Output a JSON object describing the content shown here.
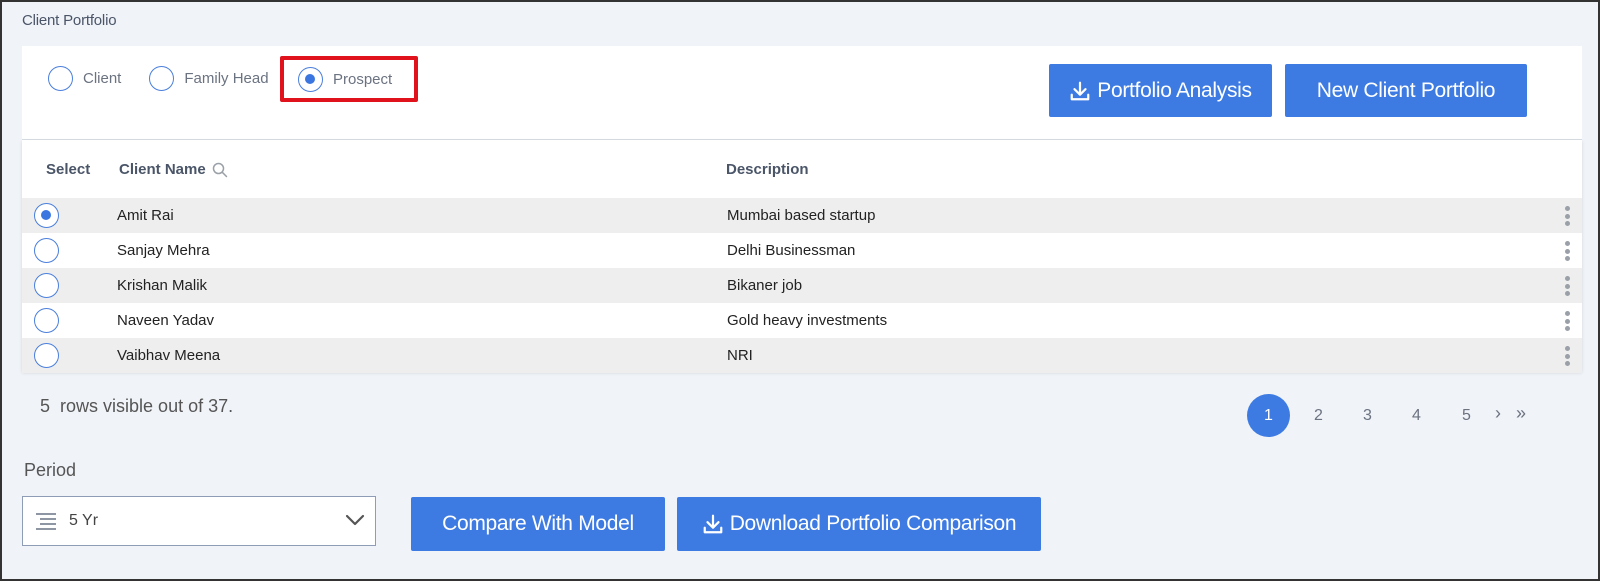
{
  "section_title": "Client Portfolio",
  "filter": {
    "options": [
      {
        "label": "Client",
        "checked": false
      },
      {
        "label": "Family Head",
        "checked": false
      },
      {
        "label": "Prospect",
        "checked": true
      }
    ]
  },
  "actions": {
    "portfolio_analysis": "Portfolio Analysis",
    "new_client_portfolio": "New Client Portfolio"
  },
  "table": {
    "headers": {
      "select": "Select",
      "client_name": "Client Name",
      "description": "Description"
    },
    "rows": [
      {
        "name": "Amit Rai",
        "description": "Mumbai based startup",
        "selected": true
      },
      {
        "name": "Sanjay Mehra",
        "description": "Delhi Businessman",
        "selected": false
      },
      {
        "name": "Krishan Malik",
        "description": "Bikaner job",
        "selected": false
      },
      {
        "name": "Naveen Yadav",
        "description": "Gold heavy investments",
        "selected": false
      },
      {
        "name": "Vaibhav Meena",
        "description": "NRI",
        "selected": false
      }
    ]
  },
  "rows_info": {
    "count": "5",
    "text": "rows visible out of 37."
  },
  "pagination": {
    "pages": [
      "1",
      "2",
      "3",
      "4",
      "5"
    ],
    "active": "1",
    "next": "›",
    "last": "»"
  },
  "period": {
    "label": "Period",
    "value": "5 Yr"
  },
  "bottom_actions": {
    "compare": "Compare With Model",
    "download": "Download Portfolio Comparison"
  },
  "colors": {
    "accent": "#3d7be2",
    "highlight_border": "#e0131d"
  }
}
